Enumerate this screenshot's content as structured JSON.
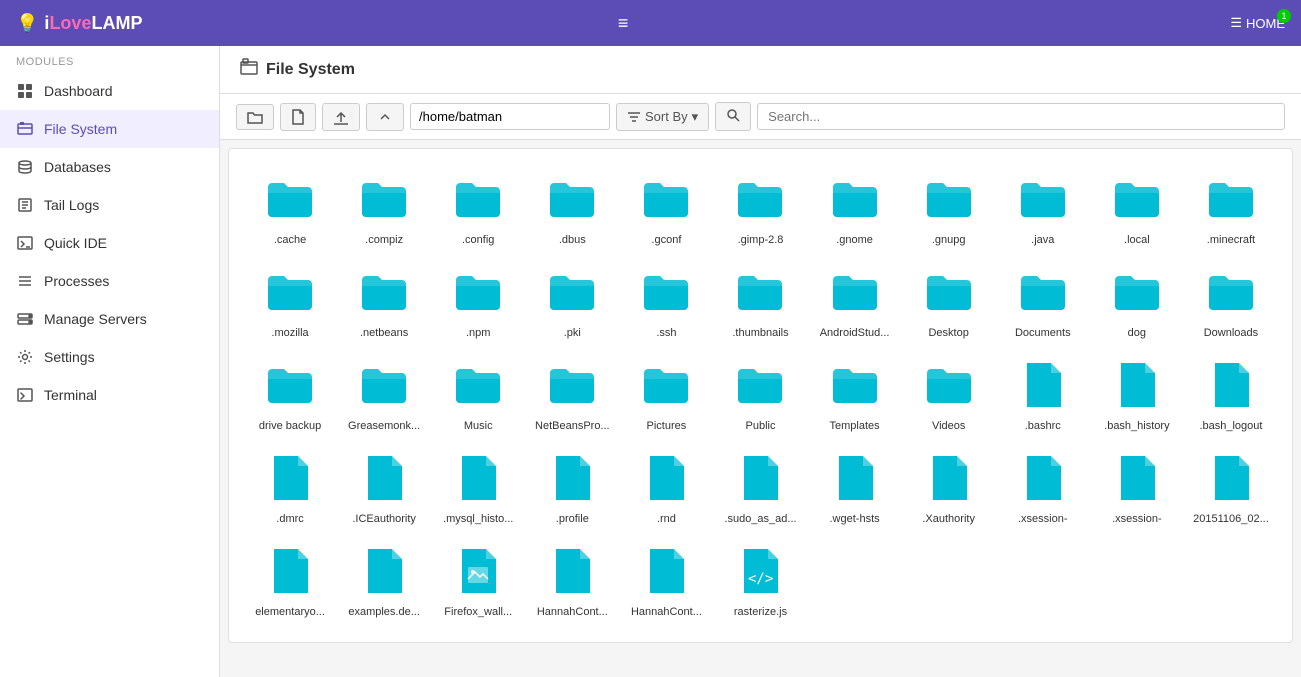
{
  "app": {
    "brand": "iLoveLAMP",
    "brand_icon": "💡",
    "home_label": "HOME",
    "home_badge": "1",
    "hamburger": "≡"
  },
  "sidebar": {
    "section_label": "Modules",
    "items": [
      {
        "id": "dashboard",
        "label": "Dashboard",
        "icon": "dashboard"
      },
      {
        "id": "filesystem",
        "label": "File System",
        "icon": "filesystem",
        "active": true
      },
      {
        "id": "databases",
        "label": "Databases",
        "icon": "databases"
      },
      {
        "id": "taillogs",
        "label": "Tail Logs",
        "icon": "taillogs"
      },
      {
        "id": "quickide",
        "label": "Quick IDE",
        "icon": "quickide"
      },
      {
        "id": "processes",
        "label": "Processes",
        "icon": "processes"
      },
      {
        "id": "manageservers",
        "label": "Manage Servers",
        "icon": "manageservers"
      },
      {
        "id": "settings",
        "label": "Settings",
        "icon": "settings"
      },
      {
        "id": "terminal",
        "label": "Terminal",
        "icon": "terminal"
      }
    ]
  },
  "page": {
    "title": "File System",
    "path": "/home/batman",
    "sort_label": "Sort By",
    "search_placeholder": "Search..."
  },
  "folders": [
    ".cache",
    ".compiz",
    ".config",
    ".dbus",
    ".gconf",
    ".gimp-2.8",
    ".gnome",
    ".gnupg",
    ".java",
    ".local",
    ".minecraft",
    ".mozilla",
    ".netbeans",
    ".npm",
    ".pki",
    ".ssh",
    ".thumbnails",
    "AndroidStud...",
    "Desktop",
    "Documents",
    "dog",
    "Downloads",
    "drive backup",
    "Greasemonk...",
    "Music",
    "NetBeansPro...",
    "Pictures",
    "Public",
    "Templates",
    "Videos"
  ],
  "files": [
    ".bashrc",
    ".bash_history",
    ".bash_logout",
    ".dmrc",
    ".ICEauthority",
    ".mysql_histo...",
    ".profile",
    ".rnd",
    ".sudo_as_ad...",
    ".wget-hsts",
    ".Xauthority",
    ".xsession-",
    ".xsession-",
    "20151106_02...",
    "elementaryo...",
    "examples.de...",
    "Firefox_wall...",
    "HannahCont...",
    "HannahCont...",
    "rasterize.js"
  ],
  "colors": {
    "folder": "#00bcd4",
    "file": "#00bcd4",
    "sidebar_active": "#5b4db5",
    "navbar_bg": "#5b4db5"
  }
}
